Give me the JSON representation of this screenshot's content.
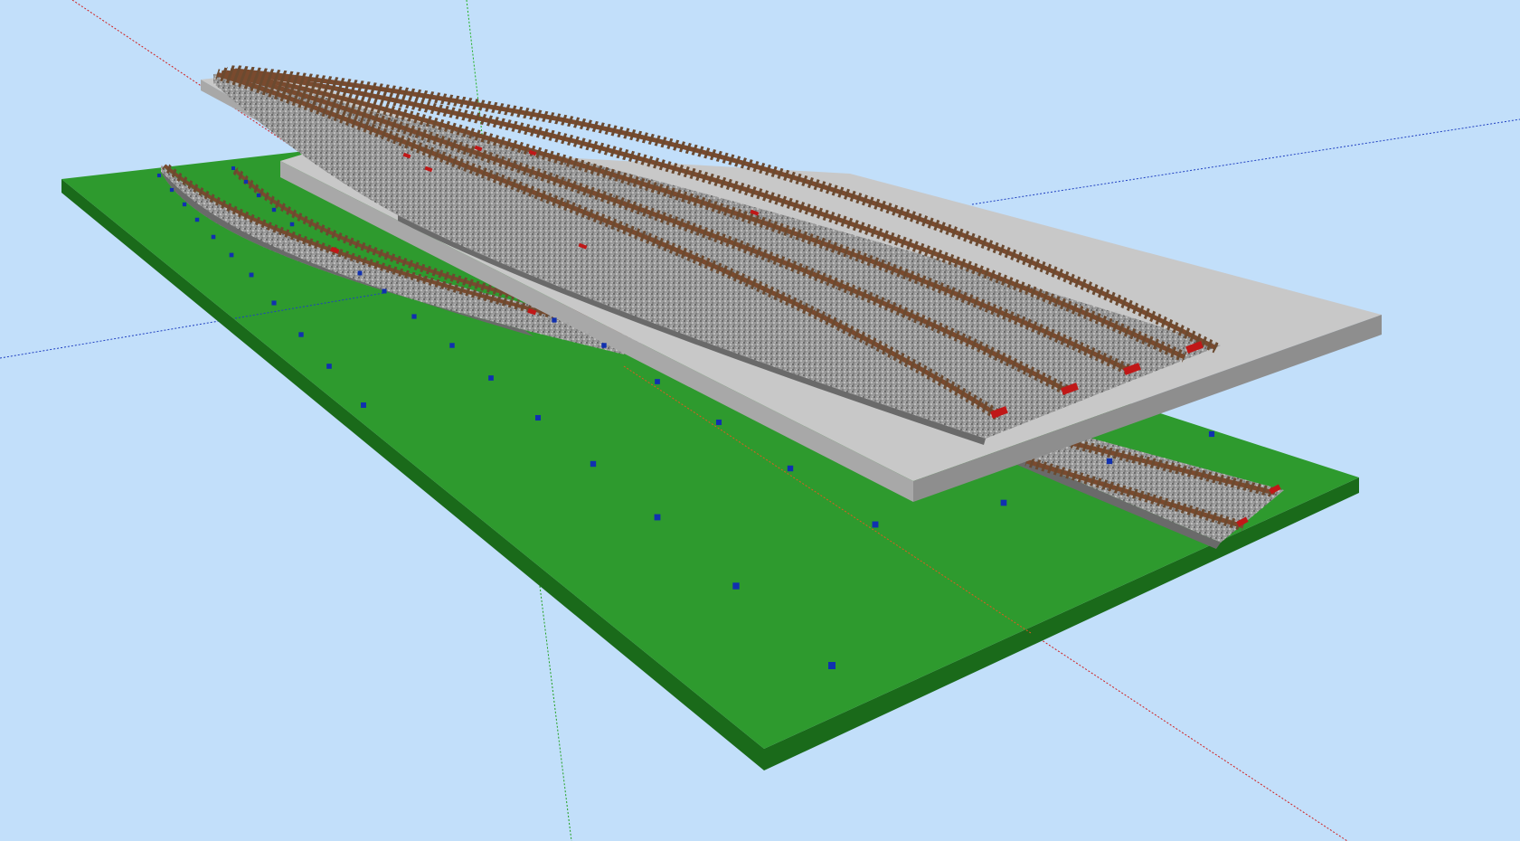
{
  "viewport": {
    "background": "#c2dffa"
  },
  "scene": {
    "axes": {
      "x_axis_color": "#e02020",
      "y_axis_color": "#20b020",
      "z_axis_color": "#2040c0"
    },
    "ground_color": "#2e9a2e",
    "ground_edge_color": "#1a6a1a",
    "platform_top_color": "#c8c8c8",
    "platform_side_color": "#a8a8a8",
    "ballast_color": "#8a8a8a",
    "rail_color": "#7a4a2e",
    "marker_color": "#1030b0",
    "buffer_color": "#c01818",
    "upper_track_count": 5,
    "lower_track_count": 2,
    "icons": [
      "cube-marker-icon",
      "track-buffer-icon"
    ]
  }
}
